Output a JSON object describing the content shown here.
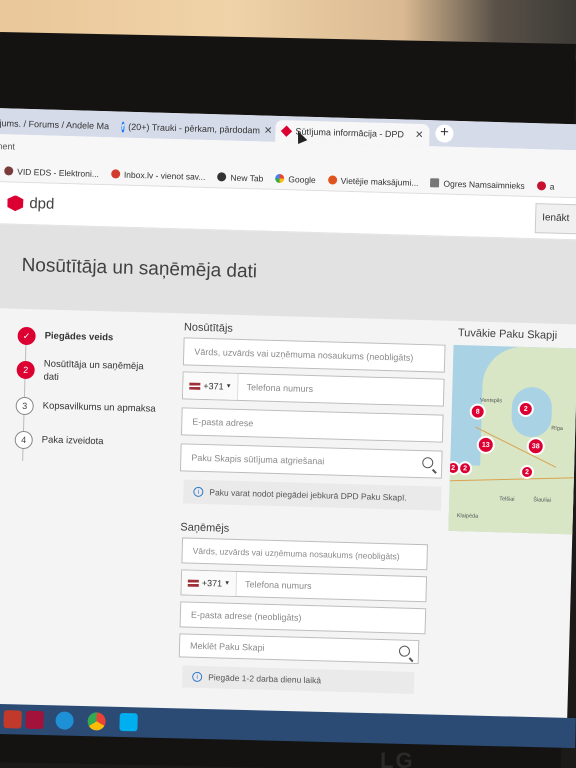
{
  "browser": {
    "tabs": [
      {
        "label": "jums. / Forums / Andele Ma",
        "close": "✕"
      },
      {
        "label": "(20+) Trauki - pērkam, pārdodam",
        "close": "✕"
      },
      {
        "label": "Sūtījuma informācija - DPD",
        "close": "✕"
      }
    ],
    "new_tab": "+",
    "address_fragment": "ment",
    "bookmarks": [
      {
        "label": "VID EDS - Elektroni...",
        "color": "#7a3b3b"
      },
      {
        "label": "Inbox.lv - vienot sav...",
        "color": "#d23b2e"
      },
      {
        "label": "New Tab",
        "color": "#333333"
      },
      {
        "label": "Google",
        "color": "#4285f4"
      },
      {
        "label": "Vietējie maksājumi...",
        "color": "#e0531e"
      },
      {
        "label": "Ogres Namsaimnieks",
        "color": "#555555"
      },
      {
        "label": "a",
        "color": "#c8102e"
      }
    ]
  },
  "site": {
    "logo": "dpd",
    "login_button": "Ienākt",
    "page_title": "Nosūtītāja un saņēmēja dati"
  },
  "steps": [
    {
      "number": "✓",
      "label": "Piegādes veids",
      "state": "done"
    },
    {
      "number": "2",
      "label": "Nosūtītāja un saņēmēja dati",
      "state": "current"
    },
    {
      "number": "3",
      "label": "Kopsavilkums un apmaksa",
      "state": "pending"
    },
    {
      "number": "4",
      "label": "Paka izveidota",
      "state": "pending"
    }
  ],
  "sender": {
    "heading": "Nosūtītājs",
    "name_placeholder": "Vārds, uzvārds vai uzņēmuma nosaukums (neobligāts)",
    "country_code": "+371",
    "phone_placeholder": "Telefona numurs",
    "email_placeholder": "E-pasta adrese",
    "locker_placeholder": "Paku Skapis sūtījuma atgriešanai",
    "info": "Paku varat nodot piegādei jebkurā DPD Paku Skapī."
  },
  "receiver": {
    "heading": "Saņēmējs",
    "name_placeholder": "Vārds, uzvārds vai uzņēmuma nosaukums (neobligāts)",
    "country_code": "+371",
    "phone_placeholder": "Telefona numurs",
    "email_placeholder": "E-pasta adrese (neobligāts)",
    "locker_placeholder": "Meklēt Paku Skapi",
    "info": "Piegāde 1-2 darba dienu laikā"
  },
  "map": {
    "title": "Tuvākie Paku Skapji",
    "clusters": [
      "8",
      "2",
      "13",
      "38",
      "2",
      "2",
      "2"
    ],
    "labels": [
      "Ventspils",
      "Rīga",
      "Telšiai",
      "Šiauliai",
      "Klaipėda"
    ]
  },
  "monitor_brand": "LG"
}
